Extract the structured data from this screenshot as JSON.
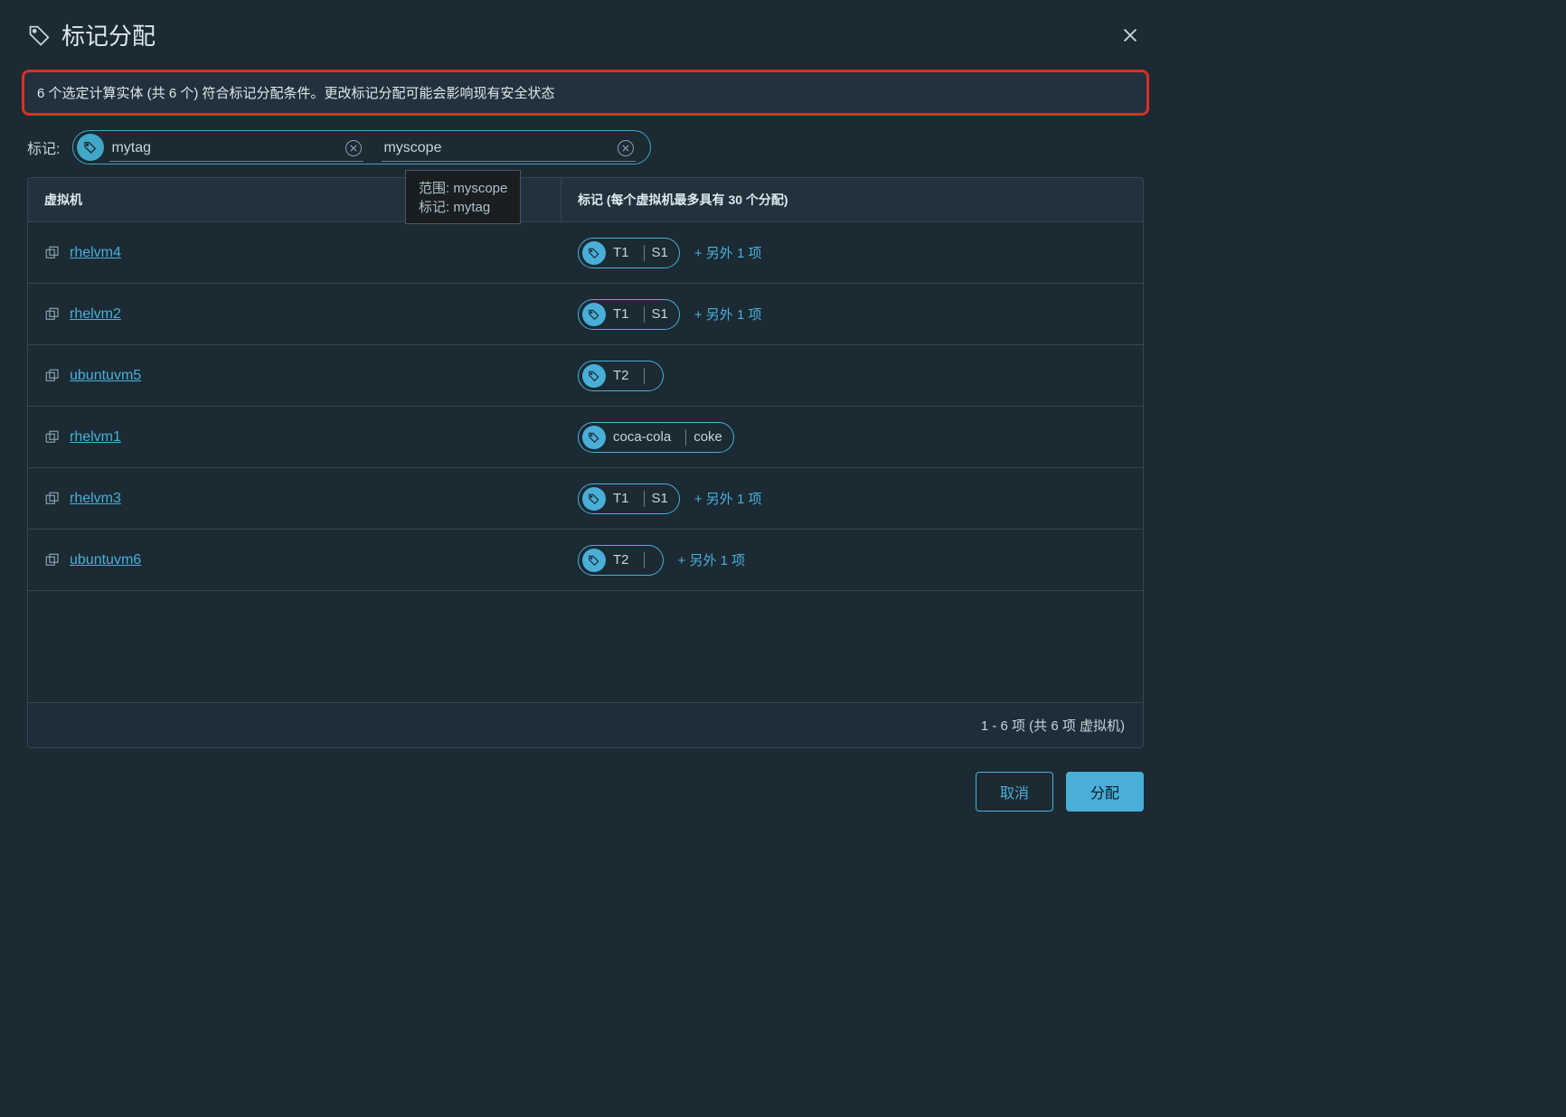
{
  "dialog": {
    "title": "标记分配",
    "banner": "6 个选定计算实体 (共 6 个) 符合标记分配条件。更改标记分配可能会影响现有安全状态"
  },
  "tag_input": {
    "label": "标记:",
    "chip1": "mytag",
    "chip2": "myscope"
  },
  "tooltip": {
    "line1": "范围: myscope",
    "line2": "标记: mytag"
  },
  "table": {
    "header_vm": "虚拟机",
    "header_tags": "标记 (每个虚拟机最多具有 30 个分配)",
    "rows": [
      {
        "vm": "rhelvm4",
        "tag_a": "T1",
        "tag_b": "S1",
        "more": "+ 另外 1 项"
      },
      {
        "vm": "rhelvm2",
        "tag_a": "T1",
        "tag_b": "S1",
        "more": "+ 另外 1 项"
      },
      {
        "vm": "ubuntuvm5",
        "tag_a": "T2",
        "tag_b": "",
        "more": ""
      },
      {
        "vm": "rhelvm1",
        "tag_a": "coca-cola",
        "tag_b": "coke",
        "more": ""
      },
      {
        "vm": "rhelvm3",
        "tag_a": "T1",
        "tag_b": "S1",
        "more": "+ 另外 1 项"
      },
      {
        "vm": "ubuntuvm6",
        "tag_a": "T2",
        "tag_b": "",
        "more": "+ 另外 1 项"
      }
    ],
    "footer": "1 - 6 项 (共 6 项 虚拟机)"
  },
  "buttons": {
    "cancel": "取消",
    "assign": "分配"
  }
}
